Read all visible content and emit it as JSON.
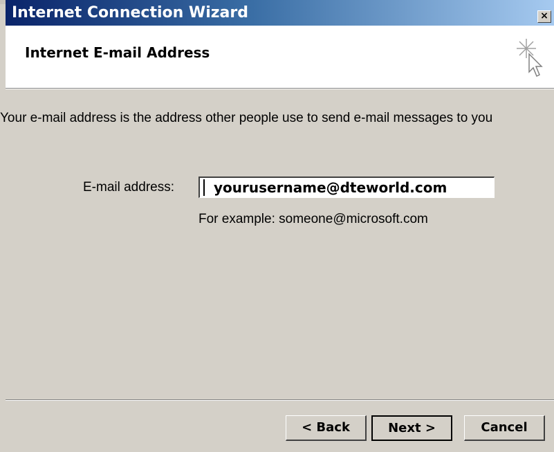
{
  "window": {
    "title": "Internet Connection Wizard",
    "close_glyph": "×"
  },
  "header": {
    "title": "Internet E-mail Address",
    "icon": "wizard-cursor-icon"
  },
  "body": {
    "intro": "Your e-mail address is the address other people use to send e-mail messages to you",
    "email_label": "E-mail address:",
    "email_value": "yourusername@dteworld.com",
    "example": "For example: someone@microsoft.com"
  },
  "buttons": {
    "back": "< Back",
    "next": "Next >",
    "cancel": "Cancel"
  },
  "colors": {
    "title_gradient_start": "#0a246a",
    "title_gradient_end": "#a6caf0",
    "face": "#d4d0c8"
  }
}
